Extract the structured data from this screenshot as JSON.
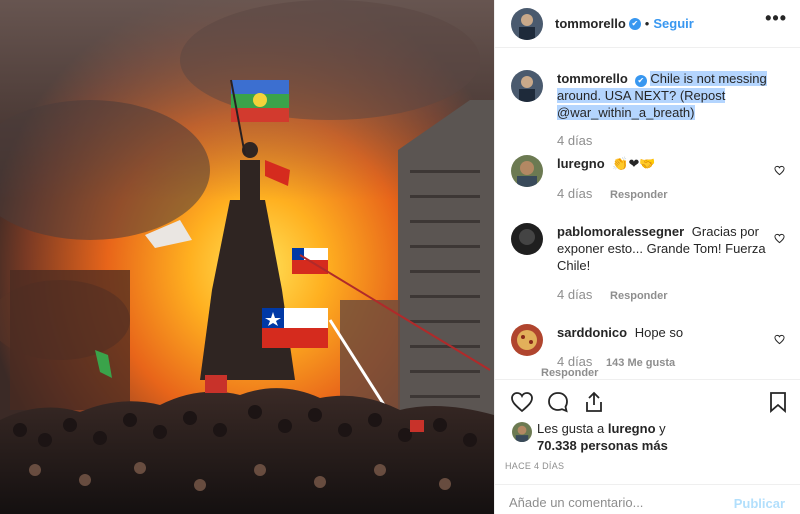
{
  "post": {
    "username": "tommorello",
    "verified_badge": "✔",
    "separator": "•",
    "follow_label": "Seguir",
    "more_label": "•••",
    "photo_icon": "photo-protest-scene"
  },
  "caption": {
    "username": "tommorello",
    "text": "Chile is not messing around. USA NEXT? (Repost @war_within_a_breath)",
    "time": "4 días"
  },
  "comments": [
    {
      "username": "luregno",
      "text": "👏❤🤝",
      "time": "4 días",
      "reply_label": "Responder"
    },
    {
      "username": "pablomoralessegner",
      "text": "Gracias por exponer esto... Grande Tom! Fuerza Chile!",
      "time": "4 días",
      "reply_label": "Responder"
    },
    {
      "username": "sarddonico",
      "text": "Hope so",
      "time": "4 días",
      "likes": "143 Me gusta",
      "reply_label": "Responder"
    }
  ],
  "likes": {
    "prefix": "Les gusta a",
    "user": "luregno",
    "connector": "y",
    "count": "70.338 personas más"
  },
  "time_ago": "HACE 4 DÍAS",
  "add_comment": {
    "placeholder": "Añade un comentario...",
    "publish_label": "Publicar"
  },
  "colors": {
    "link_blue": "#3897f0",
    "publish_disabled": "#b2dffc",
    "selection": "#b4d5fe",
    "muted": "#8e8e8e"
  }
}
